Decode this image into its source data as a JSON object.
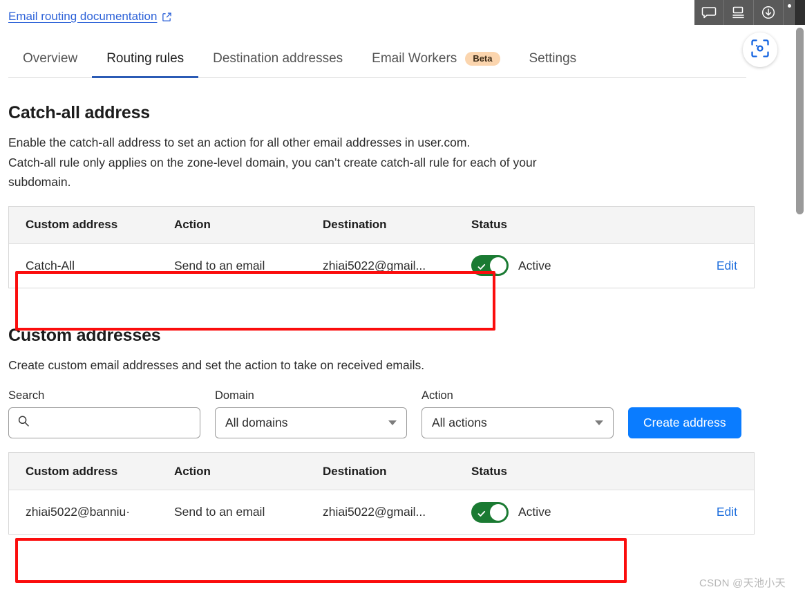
{
  "browser_toolbar": {
    "buttons": [
      {
        "name": "comment-icon",
        "label": "Comment"
      },
      {
        "name": "screen-icon",
        "label": "Screen"
      },
      {
        "name": "download-icon",
        "label": "Download"
      }
    ]
  },
  "capture_fab": {
    "label": "Capture",
    "icon": "screenshot-capture-icon"
  },
  "doc_link": {
    "label": "Email routing documentation",
    "icon": "external-link-icon"
  },
  "tabs": [
    {
      "label": "Overview",
      "active": false
    },
    {
      "label": "Routing rules",
      "active": true
    },
    {
      "label": "Destination addresses",
      "active": false
    },
    {
      "label": "Email Workers",
      "active": false,
      "badge": "Beta"
    },
    {
      "label": "Settings",
      "active": false
    }
  ],
  "catch_all": {
    "title": "Catch-all address",
    "desc_line1": "Enable the catch-all address to set an action for all other email addresses in user.com.",
    "desc_line2": "Catch-all rule only applies on the zone-level domain, you can’t create catch-all rule for each of your",
    "desc_line3": "subdomain.",
    "table": {
      "columns": [
        "Custom address",
        "Action",
        "Destination",
        "Status",
        ""
      ],
      "rows": [
        {
          "address": "Catch-All",
          "action": "Send to an email",
          "destination": "zhiai5022@gmail...",
          "status": "Active",
          "toggle_on": true,
          "edit": "Edit"
        }
      ]
    }
  },
  "custom_addresses": {
    "title": "Custom addresses",
    "desc": "Create custom email addresses and set the action to take on received emails.",
    "filters": {
      "search_label": "Search",
      "search_value": "",
      "search_placeholder": "",
      "domain_label": "Domain",
      "domain_value": "All domains",
      "action_label": "Action",
      "action_value": "All actions",
      "create_button": "Create address"
    },
    "table": {
      "columns": [
        "Custom address",
        "Action",
        "Destination",
        "Status",
        ""
      ],
      "rows": [
        {
          "address": "zhiai5022@banniu·",
          "action": "Send to an email",
          "destination": "zhiai5022@gmail...",
          "status": "Active",
          "toggle_on": true,
          "edit": "Edit"
        }
      ]
    }
  },
  "annotations": [
    {
      "name": "catch-all-row-highlight",
      "color": "#fb0d0d"
    },
    {
      "name": "custom-address-row-highlight",
      "color": "#fb0d0d"
    }
  ],
  "watermark": "CSDN @天池小天",
  "colors": {
    "accent_blue": "#0a7cff",
    "link_blue": "#2d62d8",
    "tab_underline": "#2b5bb5",
    "toggle_green": "#1a7a32",
    "badge_orange": "#fbd5ae",
    "annotation_red": "#fb0d0d"
  }
}
